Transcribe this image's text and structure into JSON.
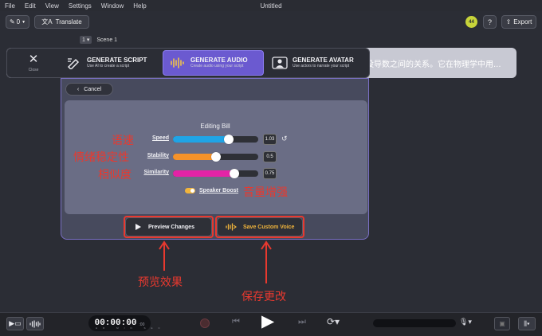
{
  "menubar": {
    "items": [
      "File",
      "Edit",
      "View",
      "Settings",
      "Window",
      "Help"
    ],
    "title": "Untitled"
  },
  "toolbar": {
    "pen_count": "0",
    "translate_label": "Translate",
    "credits_badge": "44",
    "help_label": "?",
    "export_label": "Export"
  },
  "scene": {
    "number": "1",
    "label": "Scene 1"
  },
  "script_text": "没导数之间的关系。它在物理学中用...",
  "generate_tabs": {
    "close_label": "Close",
    "tabs": [
      {
        "title": "GENERATE SCRIPT",
        "subtitle": "Use AI to create a script",
        "icon": "pen-ai-icon",
        "active": false
      },
      {
        "title": "GENERATE AUDIO",
        "subtitle": "Create audio using your script",
        "icon": "waveform-icon",
        "active": true
      },
      {
        "title": "GENERATE AVATAR",
        "subtitle": "Use actors to narrate your script",
        "icon": "avatar-icon",
        "active": false
      }
    ]
  },
  "panel": {
    "cancel_label": "Cancel",
    "editing_title": "Editing Bill",
    "sliders": [
      {
        "label": "Speed",
        "value_text": "1.03",
        "fill_fraction": 0.65,
        "color": "#1fa4e6"
      },
      {
        "label": "Stability",
        "value_text": "0.5",
        "fill_fraction": 0.5,
        "color": "#f5922a"
      },
      {
        "label": "Similarity",
        "value_text": "0.75",
        "fill_fraction": 0.72,
        "color": "#e323a6"
      }
    ],
    "speaker_boost_label": "Speaker Boost",
    "speaker_boost_on": true,
    "preview_label": "Preview Changes",
    "save_label": "Save Custom Voice"
  },
  "annotations": {
    "speed": "语速",
    "stability": "情绪稳定性",
    "similarity": "相似度",
    "boost": "音量增强",
    "preview": "预览效果",
    "save": "保存更改",
    "color": "#e8392f"
  },
  "playback": {
    "timecode": "00:00:00",
    "frames": ":00",
    "units": "HR MIN SEC"
  }
}
